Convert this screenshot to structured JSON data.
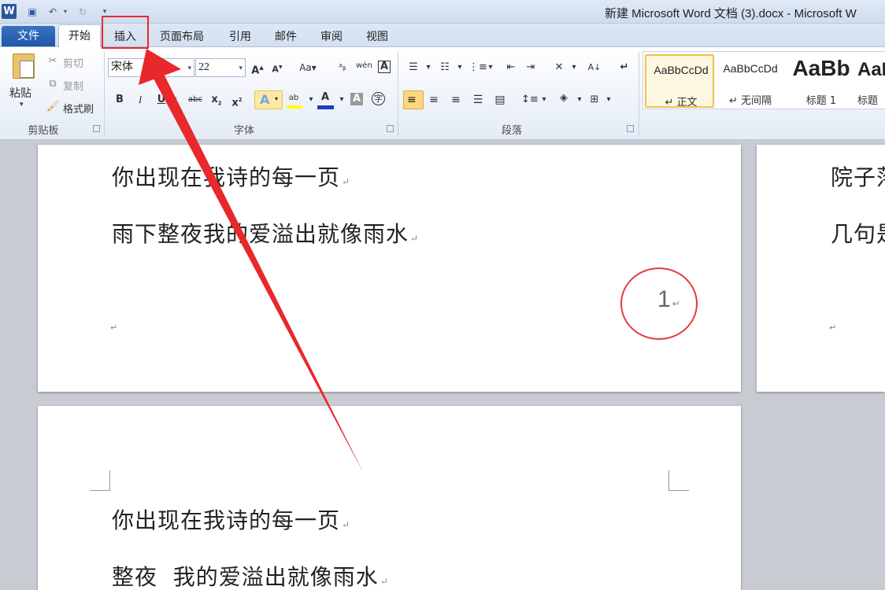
{
  "window": {
    "app_letter": "W",
    "title": "新建 Microsoft Word 文档 (3).docx - Microsoft W",
    "quick_access": [
      {
        "name": "save-icon",
        "glyph": "▣"
      },
      {
        "name": "undo-icon",
        "glyph": "↶"
      },
      {
        "name": "redo-icon",
        "glyph": "↻"
      }
    ]
  },
  "tabs": {
    "file": "文件",
    "items": [
      "开始",
      "插入",
      "页面布局",
      "引用",
      "邮件",
      "审阅",
      "视图"
    ],
    "active": "开始",
    "highlighted": "插入"
  },
  "ribbon": {
    "clipboard": {
      "label": "剪贴板",
      "paste": "粘贴",
      "cut": "剪切",
      "copy": "复制",
      "format_painter": "格式刷"
    },
    "font": {
      "label": "字体",
      "font_name": "宋体",
      "font_size": "22",
      "font_color": "#1f3fbf",
      "highlight_color": "#ffff00"
    },
    "paragraph": {
      "label": "段落"
    },
    "styles": {
      "items": [
        {
          "sample": "AaBbCcDd",
          "name": "↵ 正文"
        },
        {
          "sample": "AaBbCcDd",
          "name": "↵ 无间隔"
        },
        {
          "sample": "AaBb",
          "name": "标题 1"
        },
        {
          "sample": "AaB",
          "name": "标题"
        }
      ]
    }
  },
  "document": {
    "page1": {
      "lines": [
        "你出现在我诗的每一页",
        "雨下整夜我的爱溢出就像雨水"
      ],
      "page_number": "1"
    },
    "page2_right": {
      "lines": [
        "院子落",
        "几句是"
      ]
    },
    "page3": {
      "lines": [
        "你出现在我诗的每一页",
        "整夜  我的爱溢出就像雨水"
      ]
    },
    "para_mark": "↵"
  },
  "annotation": {
    "color": "#e8282b"
  }
}
